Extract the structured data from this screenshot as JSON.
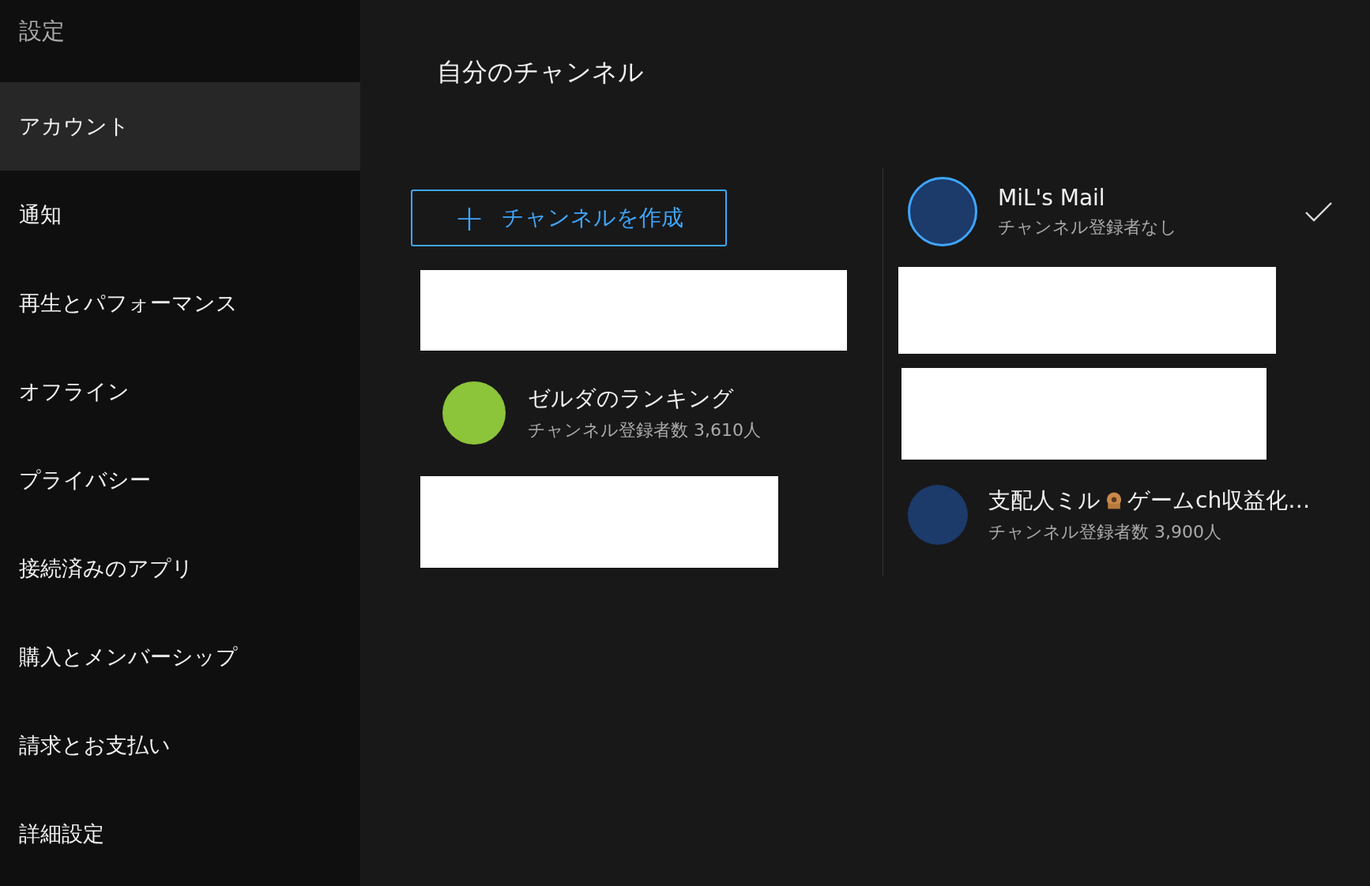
{
  "sidebar": {
    "title": "設定",
    "items": [
      {
        "label": "アカウント",
        "selected": true
      },
      {
        "label": "通知",
        "selected": false
      },
      {
        "label": "再生とパフォーマンス",
        "selected": false
      },
      {
        "label": "オフライン",
        "selected": false
      },
      {
        "label": "プライバシー",
        "selected": false
      },
      {
        "label": "接続済みのアプリ",
        "selected": false
      },
      {
        "label": "購入とメンバーシップ",
        "selected": false
      },
      {
        "label": "請求とお支払い",
        "selected": false
      },
      {
        "label": "詳細設定",
        "selected": false
      }
    ]
  },
  "main": {
    "title": "自分のチャンネル",
    "create_button": {
      "icon": "+",
      "label": "チャンネルを作成"
    },
    "left_channels": [
      {
        "kind": "redacted"
      },
      {
        "kind": "channel",
        "name": [
          "ゼルダのランキング"
        ],
        "subscribers": "チャンネル登録者数 3,610人",
        "selected": false
      },
      {
        "kind": "redacted"
      }
    ],
    "right_channels": [
      {
        "kind": "channel",
        "name": [
          "MiL's Mail"
        ],
        "subscribers": "チャンネル登録者なし",
        "selected": true
      },
      {
        "kind": "redacted"
      },
      {
        "kind": "redacted"
      },
      {
        "kind": "channel",
        "name": [
          "支配人ミル",
          "ゲームch収益化…"
        ],
        "subscribers": "チャンネル登録者数 3,900人",
        "selected": false
      }
    ]
  }
}
